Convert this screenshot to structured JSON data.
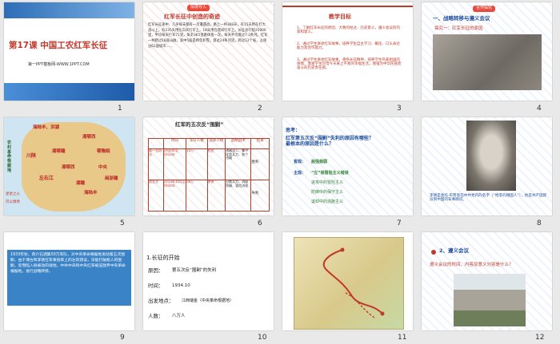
{
  "slides": [
    {
      "num": "1",
      "title": "第17课 中国工农红军长征",
      "footer": "第一PPT模板网-WWW.1PPT.COM"
    },
    {
      "num": "2",
      "badge": "情境导入",
      "heading": "红军长征中创造的奇迹",
      "body": "红军长征途中，几乎每天都有一次遭遇战，路上一共368天，有15天用在打大战斗上，有235天用在白天行军上，18天用在夜间行军上。长征总行程25000里，平均每天行军71里，每走365里路休息一次，每天平均渡过7.2条河。红军一共爬过18座山脉，其中5座是终年积雪。渡过24条河流，跨过12个省，占领过62座城市……"
    },
    {
      "num": "3",
      "heading": "教学目标",
      "points": [
        "1、了解红军长征的原因、大致的经过、历史意义，遵义会议的内容和意义。",
        "2、通过学生讲述红军故事，培养学生自主学习、概括、口头表达能力及合作能力。",
        "3、通过学生讲述红军故事，感悟长征精神，培养学生热爱祖国的感情，激发学生珍惜今天来之不易的幸福生活，增强为中华民族而奋斗的历史责任感。"
      ]
    },
    {
      "num": "4",
      "badge": "合作探究",
      "heading": "一、战略转移与遵义会议",
      "sub": "探究一：红军长征的原因"
    },
    {
      "num": "5",
      "map_labels": [
        "海陆丰",
        "海陆丰、洪湖",
        "湘鄂西",
        "川陕",
        "湘鄂赣",
        "鄂豫皖",
        "湘鄂西",
        "中央",
        "闽浙赣",
        "湘赣",
        "左右江",
        "琼崖",
        "海陆丰"
      ],
      "side_text": "农村革命根据地",
      "legend": [
        "星星之火",
        "可以燎原"
      ]
    },
    {
      "num": "6",
      "heading": "红军的五次反“围剿”",
      "headers": [
        "时间",
        "军队人数",
        "战争人物",
        "战略战术",
        "结果"
      ],
      "rows": [
        [
          "第一至四次",
          "1930年至1933年",
          "10万",
          "农民",
          "诱敌深入、集中优势兵力、各个击破",
          "胜利"
        ],
        [
          "第五次",
          "1933年10月至1934年",
          "50万",
          "李德",
          "分散兵力、消极防御、冒险进攻",
          "失利"
        ]
      ]
    },
    {
      "num": "7",
      "q": "思考：",
      "q_text": "红军第五次反“围剿”失利的原因有哪些？最根本的原因是什么？",
      "a1": "客观：",
      "a1_text": "敌强我弱",
      "a2": "主观：",
      "a2_text": "“左”倾冒险主义错误",
      "lines": [
        "进攻中的冒险主义",
        "防御中的保守主义",
        "退却中的逃跑主义"
      ]
    },
    {
      "num": "8",
      "caption": "李德是奥托·布劳恩在中共党内的名字（“姓李的德国人”），他是共产国际派到中国的军事顾问。"
    },
    {
      "num": "9",
      "text": "1933年秋，蒋介石调集50万军队，对中央革命根据地发动第五次围剿，由于博古和李德在军事指挥上的左的错误，没能打破敌人的围剿，反而陷入很被动的境地。中共中央和中央红军被迫放弃中央革命根据地，进行战略转移。"
    },
    {
      "num": "10",
      "heading": "1.长征的开始",
      "rows": [
        [
          "原因：",
          "第五次反“围剿”的失利"
        ],
        [
          "时间：",
          "1934.10"
        ],
        [
          "出发地点：",
          "江西瑞金（中央革命根据地）"
        ],
        [
          "人数：",
          "八万人"
        ]
      ]
    },
    {
      "num": "11"
    },
    {
      "num": "12",
      "heading": "2、遵义会议",
      "q": "遵义会议的时间、内容及意义分别是什么？"
    }
  ],
  "colors": {
    "red": "#c0392b",
    "blue": "#1f4e9c",
    "green": "#2e7d32"
  }
}
